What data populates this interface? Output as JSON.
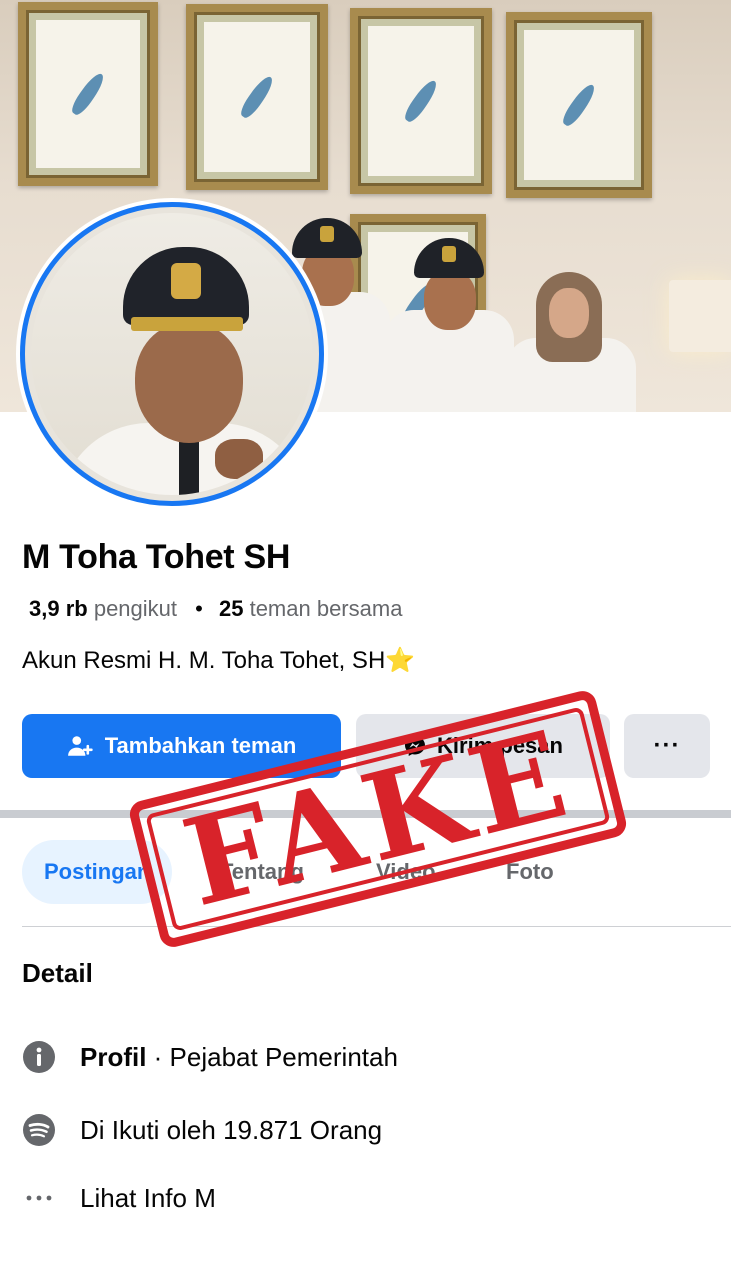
{
  "profile": {
    "name": "M Toha Tohet SH",
    "followers_count": "3,9 rb",
    "followers_label": "pengikut",
    "mutual_count": "25",
    "mutual_label": "teman bersama",
    "bio": "Akun Resmi H. M. Toha Tohet, SH⭐"
  },
  "actions": {
    "add_friend": "Tambahkan teman",
    "message": "Kirim pesan",
    "more": "···"
  },
  "tabs": [
    {
      "label": "Postingan",
      "active": true
    },
    {
      "label": "Tentang",
      "active": false
    },
    {
      "label": "Video",
      "active": false
    },
    {
      "label": "Foto",
      "active": false
    }
  ],
  "details": {
    "title": "Detail",
    "profile_bold": "Profil",
    "profile_rest": " · Pejabat Pemerintah",
    "followed_by": "Di Ikuti oleh 19.871 Orang",
    "see_info": "Lihat Info M"
  },
  "stamp": {
    "text": "FAKE",
    "color": "#d8232a"
  },
  "colors": {
    "accent": "#1877f2",
    "secondary_button": "#e4e6eb",
    "muted_text": "#65676b"
  },
  "icons": {
    "add_friend": "add-friend-icon",
    "message": "messenger-icon",
    "info": "info-icon",
    "followers": "feed-icon",
    "more": "more-dots-icon"
  }
}
